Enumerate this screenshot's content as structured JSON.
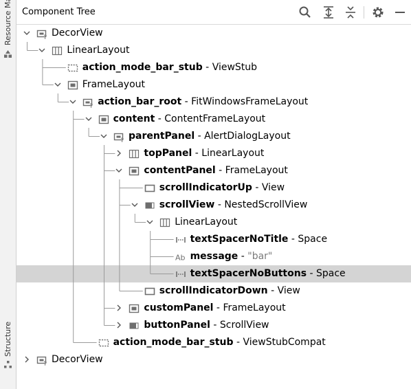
{
  "panel": {
    "title": "Component Tree"
  },
  "side": {
    "top_label": "Resource Manager",
    "bottom_label": "Structure"
  },
  "toolbar": {
    "search": "search-icon",
    "expand": "expand-all-icon",
    "collapse": "collapse-all-icon",
    "settings": "gear-icon",
    "hide": "minimize-icon"
  },
  "rows": [
    {
      "depth": 0,
      "chev": "down",
      "icon": "decor",
      "name": "DecorView",
      "plain": true,
      "sep": "",
      "type": ""
    },
    {
      "depth": 1,
      "chev": "down",
      "icon": "linear",
      "name": "LinearLayout",
      "plain": true,
      "sep": "",
      "type": ""
    },
    {
      "depth": 2,
      "chev": "none",
      "icon": "stub",
      "name": "action_mode_bar_stub",
      "plain": false,
      "sep": " - ",
      "type": "ViewStub"
    },
    {
      "depth": 2,
      "chev": "down",
      "icon": "frame",
      "name": "FrameLayout",
      "plain": true,
      "sep": "",
      "type": ""
    },
    {
      "depth": 3,
      "chev": "down",
      "icon": "decor",
      "name": "action_bar_root",
      "plain": false,
      "sep": " - ",
      "type": "FitWindowsFrameLayout"
    },
    {
      "depth": 4,
      "chev": "down",
      "icon": "frame",
      "name": "content",
      "plain": false,
      "sep": " - ",
      "type": "ContentFrameLayout"
    },
    {
      "depth": 5,
      "chev": "down",
      "icon": "decor",
      "name": "parentPanel",
      "plain": false,
      "sep": " - ",
      "type": "AlertDialogLayout"
    },
    {
      "depth": 6,
      "chev": "right",
      "icon": "linear",
      "name": "topPanel",
      "plain": false,
      "sep": " - ",
      "type": "LinearLayout"
    },
    {
      "depth": 6,
      "chev": "down",
      "icon": "frame",
      "name": "contentPanel",
      "plain": false,
      "sep": " - ",
      "type": "FrameLayout"
    },
    {
      "depth": 7,
      "chev": "none",
      "icon": "view",
      "name": "scrollIndicatorUp",
      "plain": false,
      "sep": " - ",
      "type": "View"
    },
    {
      "depth": 7,
      "chev": "down",
      "icon": "scroll",
      "name": "scrollView",
      "plain": false,
      "sep": " - ",
      "type": "NestedScrollView"
    },
    {
      "depth": 8,
      "chev": "down",
      "icon": "linear",
      "name": "LinearLayout",
      "plain": true,
      "sep": "",
      "type": ""
    },
    {
      "depth": 9,
      "chev": "none",
      "icon": "space",
      "name": "textSpacerNoTitle",
      "plain": false,
      "sep": " - ",
      "type": "Space"
    },
    {
      "depth": 9,
      "chev": "none",
      "icon": "text",
      "name": "message",
      "plain": false,
      "sep": " - ",
      "type": "\"bar\"",
      "isString": true
    },
    {
      "depth": 9,
      "chev": "none",
      "icon": "space",
      "name": "textSpacerNoButtons",
      "plain": false,
      "sep": " - ",
      "type": "Space",
      "selected": true
    },
    {
      "depth": 7,
      "chev": "none",
      "icon": "view",
      "name": "scrollIndicatorDown",
      "plain": false,
      "sep": " - ",
      "type": "View"
    },
    {
      "depth": 6,
      "chev": "right",
      "icon": "frame",
      "name": "customPanel",
      "plain": false,
      "sep": " - ",
      "type": "FrameLayout"
    },
    {
      "depth": 6,
      "chev": "right",
      "icon": "scroll",
      "name": "buttonPanel",
      "plain": false,
      "sep": " - ",
      "type": "ScrollView"
    },
    {
      "depth": 4,
      "chev": "none",
      "icon": "stub",
      "name": "action_mode_bar_stub",
      "plain": false,
      "sep": " - ",
      "type": "ViewStubCompat"
    },
    {
      "depth": 0,
      "chev": "right",
      "icon": "decor",
      "name": "DecorView",
      "plain": true,
      "sep": "",
      "type": ""
    }
  ],
  "colors": {
    "selection": "#d4d4d4",
    "guide": "#9a9a9a",
    "icon": "#6e6e6e"
  }
}
